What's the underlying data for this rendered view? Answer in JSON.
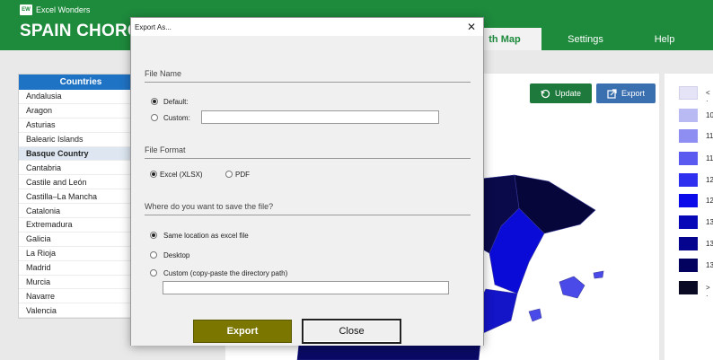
{
  "app": {
    "brand_logo": "EW",
    "brand": "Excel Wonders",
    "title": "SPAIN CHOROP"
  },
  "nav": {
    "tabs": [
      {
        "label": "th Map",
        "active": true
      },
      {
        "label": "Settings",
        "active": false
      },
      {
        "label": "Help",
        "active": false
      }
    ]
  },
  "countries": {
    "header": "Countries",
    "items": [
      "Andalusia",
      "Aragon",
      "Asturias",
      "Balearic Islands",
      "Basque Country",
      "Cantabria",
      "Castile and León",
      "Castilla–La Mancha",
      "Catalonia",
      "Extremadura",
      "Galicia",
      "La Rioja",
      "Madrid",
      "Murcia",
      "Navarre",
      "Valencia"
    ],
    "selected": "Basque Country"
  },
  "map_toolbar": {
    "update_label": "Update",
    "export_label": "Export"
  },
  "legend": {
    "items": [
      {
        "label": "< ·",
        "color": "#e4e4f6"
      },
      {
        "label": "10",
        "color": "#b9b9f4"
      },
      {
        "label": "11",
        "color": "#8e8ef2"
      },
      {
        "label": "11",
        "color": "#5a5af0"
      },
      {
        "label": "12",
        "color": "#2f2ff0"
      },
      {
        "label": "12",
        "color": "#0b0bea"
      },
      {
        "label": "13",
        "color": "#0707b8"
      },
      {
        "label": "13",
        "color": "#04048e"
      },
      {
        "label": "13",
        "color": "#03035f"
      },
      {
        "label": "> ·",
        "color": "#0a0a24"
      }
    ]
  },
  "dialog": {
    "title": "Export As...",
    "close_glyph": "✕",
    "file_name": {
      "section": "File Name",
      "default_label": "Default:",
      "custom_label": "Custom:",
      "custom_value": "",
      "selected": "default"
    },
    "file_format": {
      "section": "File Format",
      "excel_label": "Excel (XLSX)",
      "pdf_label": "PDF",
      "selected": "excel"
    },
    "location": {
      "section": "Where do you want to save the file?",
      "same_label": "Same location as excel file",
      "desktop_label": "Desktop",
      "custom_label": "Custom (copy-paste the directory path)",
      "custom_value": "",
      "selected": "same"
    },
    "export_label": "Export",
    "close_label": "Close"
  },
  "colors": {
    "header_green": "#1e8a3c",
    "countries_blue": "#1f73c4",
    "export_olive": "#7a7600"
  }
}
